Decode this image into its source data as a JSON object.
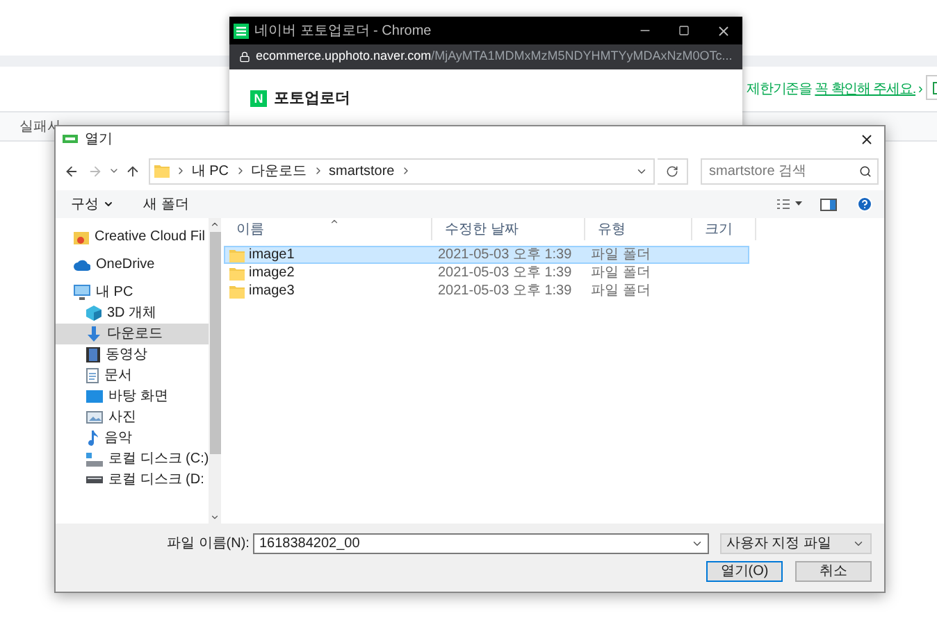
{
  "page": {
    "left_label": "실패사",
    "notice": {
      "text": "제한기준을 ",
      "link": "꼭 확인해 주세요.",
      "chevron": "›"
    }
  },
  "browser_window": {
    "title": "네이버 포토업로더 - Chrome",
    "url_host": "ecommerce.upphoto.naver.com",
    "url_path": "/MjAyMTA1MDMxMzM5NDYHMTYyMDAxNzM0OTc...",
    "logo_letter": "N",
    "app_title": "포토업로더"
  },
  "dialog": {
    "title": "열기",
    "breadcrumb": [
      "내 PC",
      "다운로드",
      "smartstore"
    ],
    "search": {
      "placeholder": "smartstore 검색"
    },
    "toolbar": {
      "organize": "구성",
      "new_folder": "새 폴더"
    },
    "sidebar": [
      {
        "label": "Creative Cloud Fil",
        "kind": "cloud",
        "selected": false
      },
      {
        "label": "OneDrive",
        "kind": "onedrive",
        "selected": false
      },
      {
        "label": "내 PC",
        "kind": "pc",
        "selected": false,
        "children": [
          {
            "label": "3D 개체",
            "kind": "cube",
            "selected": false
          },
          {
            "label": "다운로드",
            "kind": "download",
            "selected": true
          },
          {
            "label": "동영상",
            "kind": "video",
            "selected": false
          },
          {
            "label": "문서",
            "kind": "document",
            "selected": false
          },
          {
            "label": "바탕 화면",
            "kind": "desktop",
            "selected": false
          },
          {
            "label": "사진",
            "kind": "picture",
            "selected": false
          },
          {
            "label": "음악",
            "kind": "music",
            "selected": false
          },
          {
            "label": "로컬 디스크 (C:)",
            "kind": "disk",
            "selected": false
          },
          {
            "label": "로컬 디스크 (D:",
            "kind": "drive",
            "selected": false
          }
        ]
      }
    ],
    "columns": [
      "이름",
      "수정한 날짜",
      "유형",
      "크기"
    ],
    "rows": [
      {
        "name": "image1",
        "modified": "2021-05-03 오후 1:39",
        "type": "파일 폴더",
        "selected": true
      },
      {
        "name": "image2",
        "modified": "2021-05-03 오후 1:39",
        "type": "파일 폴더",
        "selected": false
      },
      {
        "name": "image3",
        "modified": "2021-05-03 오후 1:39",
        "type": "파일 폴더",
        "selected": false
      }
    ],
    "file_name_label": "파일 이름(N):",
    "file_name": "1618384202_00",
    "file_type": "사용자 지정 파일",
    "buttons": [
      "열기(O)",
      "취소"
    ]
  }
}
